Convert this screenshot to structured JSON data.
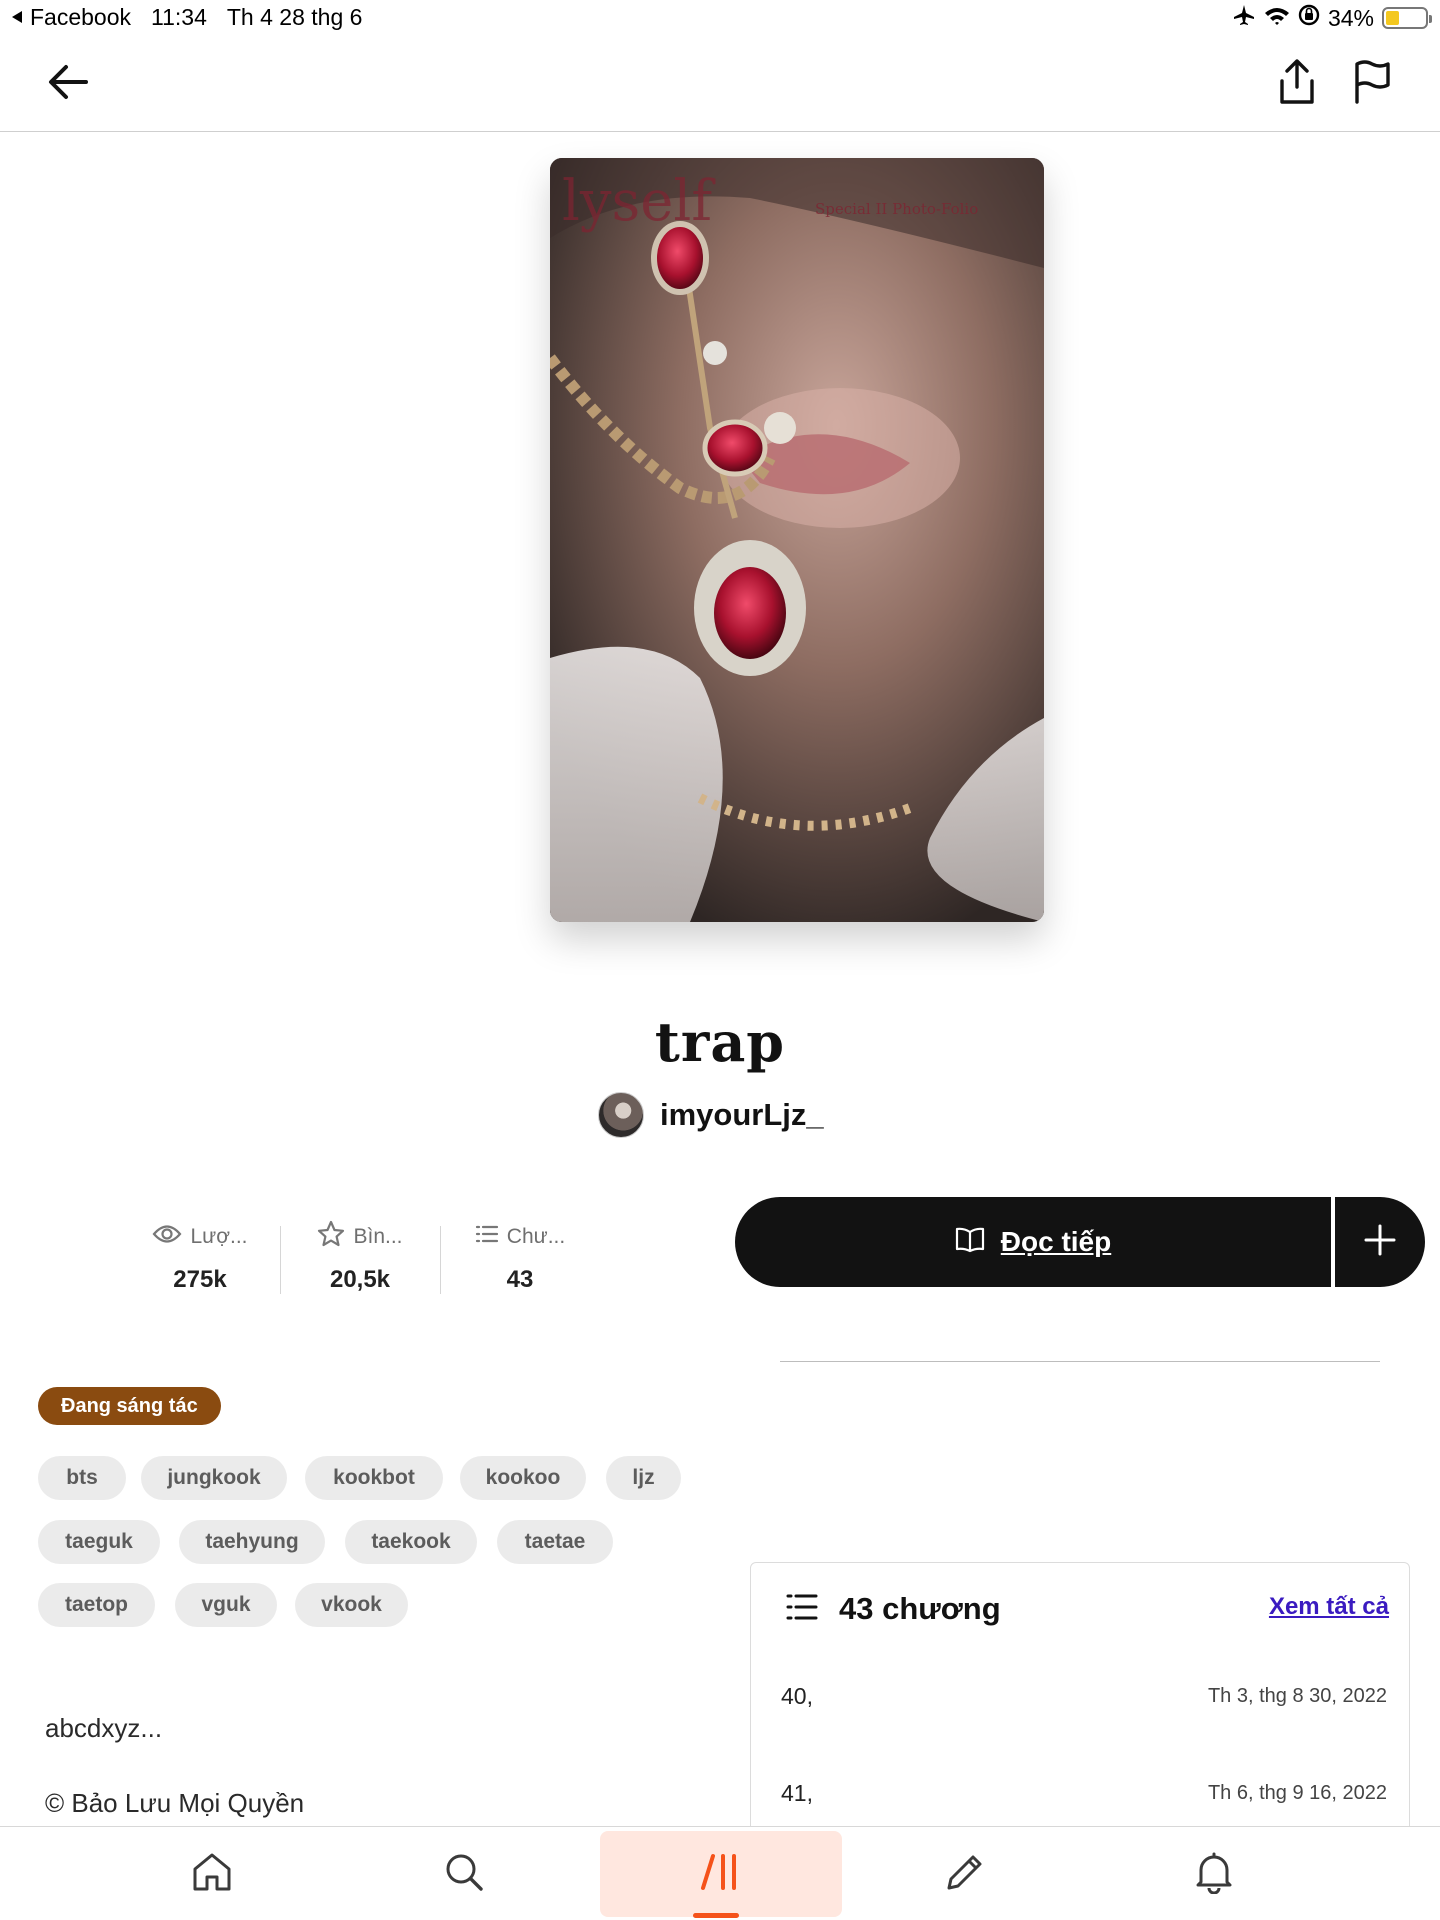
{
  "status_bar": {
    "back_app": "Facebook",
    "time": "11:34",
    "date": "Th 4 28 thg 6",
    "battery": "34%"
  },
  "story": {
    "title": "trap",
    "author": "imyourLjz_",
    "cover_text_left": "lyself",
    "cover_text_right": "Special II Photo-Folio"
  },
  "stats": [
    {
      "icon": "eye-icon",
      "label": "Lượ...",
      "value": "275k"
    },
    {
      "icon": "star-icon",
      "label": "Bìn...",
      "value": "20,5k"
    },
    {
      "icon": "list-icon",
      "label": "Chư...",
      "value": "43"
    }
  ],
  "actions": {
    "read_label": "Đọc tiếp"
  },
  "status_badge": "Đang sáng tác",
  "tags": [
    "bts",
    "jungkook",
    "kookbot",
    "kookoo",
    "ljz",
    "taeguk",
    "taehyung",
    "taekook",
    "taetae",
    "taetop",
    "vguk",
    "vkook"
  ],
  "description": [
    "abcdxyz...",
    "© Bảo Lưu Mọi Quyền"
  ],
  "chapters": {
    "count_label": "43 chương",
    "see_all": "Xem tất cả",
    "items": [
      {
        "title": "40,",
        "date": "Th 3, thg 8 30, 2022"
      },
      {
        "title": "41,",
        "date": "Th 6, thg 9 16, 2022"
      }
    ]
  },
  "nav": {
    "items": [
      "home-icon",
      "search-icon",
      "library-icon",
      "write-icon",
      "notifications-icon"
    ],
    "active": "library-icon"
  },
  "colors": {
    "accent": "#f5521a",
    "badge": "#8a4b10",
    "link": "#3a1bc0",
    "button": "#121212"
  }
}
